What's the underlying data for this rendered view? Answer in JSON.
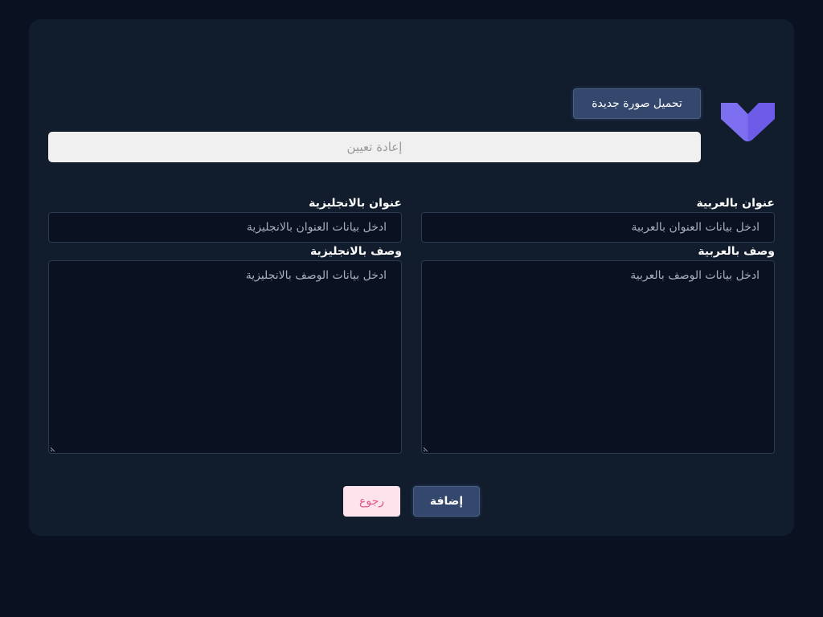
{
  "colors": {
    "background": "#0a1120",
    "card": "#111c2c",
    "primary_button": "#34486e",
    "logo": "#6c5ce7",
    "back_button_bg": "#fde4ec",
    "back_button_text": "#e0568a"
  },
  "logo": {
    "icon": "check-chevron-logo"
  },
  "image": {
    "upload_label": "تحميل صورة جديدة",
    "reset_label": "إعادة تعيين"
  },
  "form": {
    "title_ar": {
      "label": "عنوان بالعربية",
      "placeholder": "ادخل بيانات العنوان بالعربية"
    },
    "title_en": {
      "label": "عنوان بالانجليزية",
      "placeholder": "ادخل بيانات العنوان بالانجليزية"
    },
    "desc_ar": {
      "label": "وصف بالعربية",
      "placeholder": "ادخل بيانات الوصف بالعربية"
    },
    "desc_en": {
      "label": "وصف بالانجليزية",
      "placeholder": "ادخل بيانات الوصف بالانجليزية"
    }
  },
  "actions": {
    "add_label": "إضافة",
    "back_label": "رجوع"
  }
}
